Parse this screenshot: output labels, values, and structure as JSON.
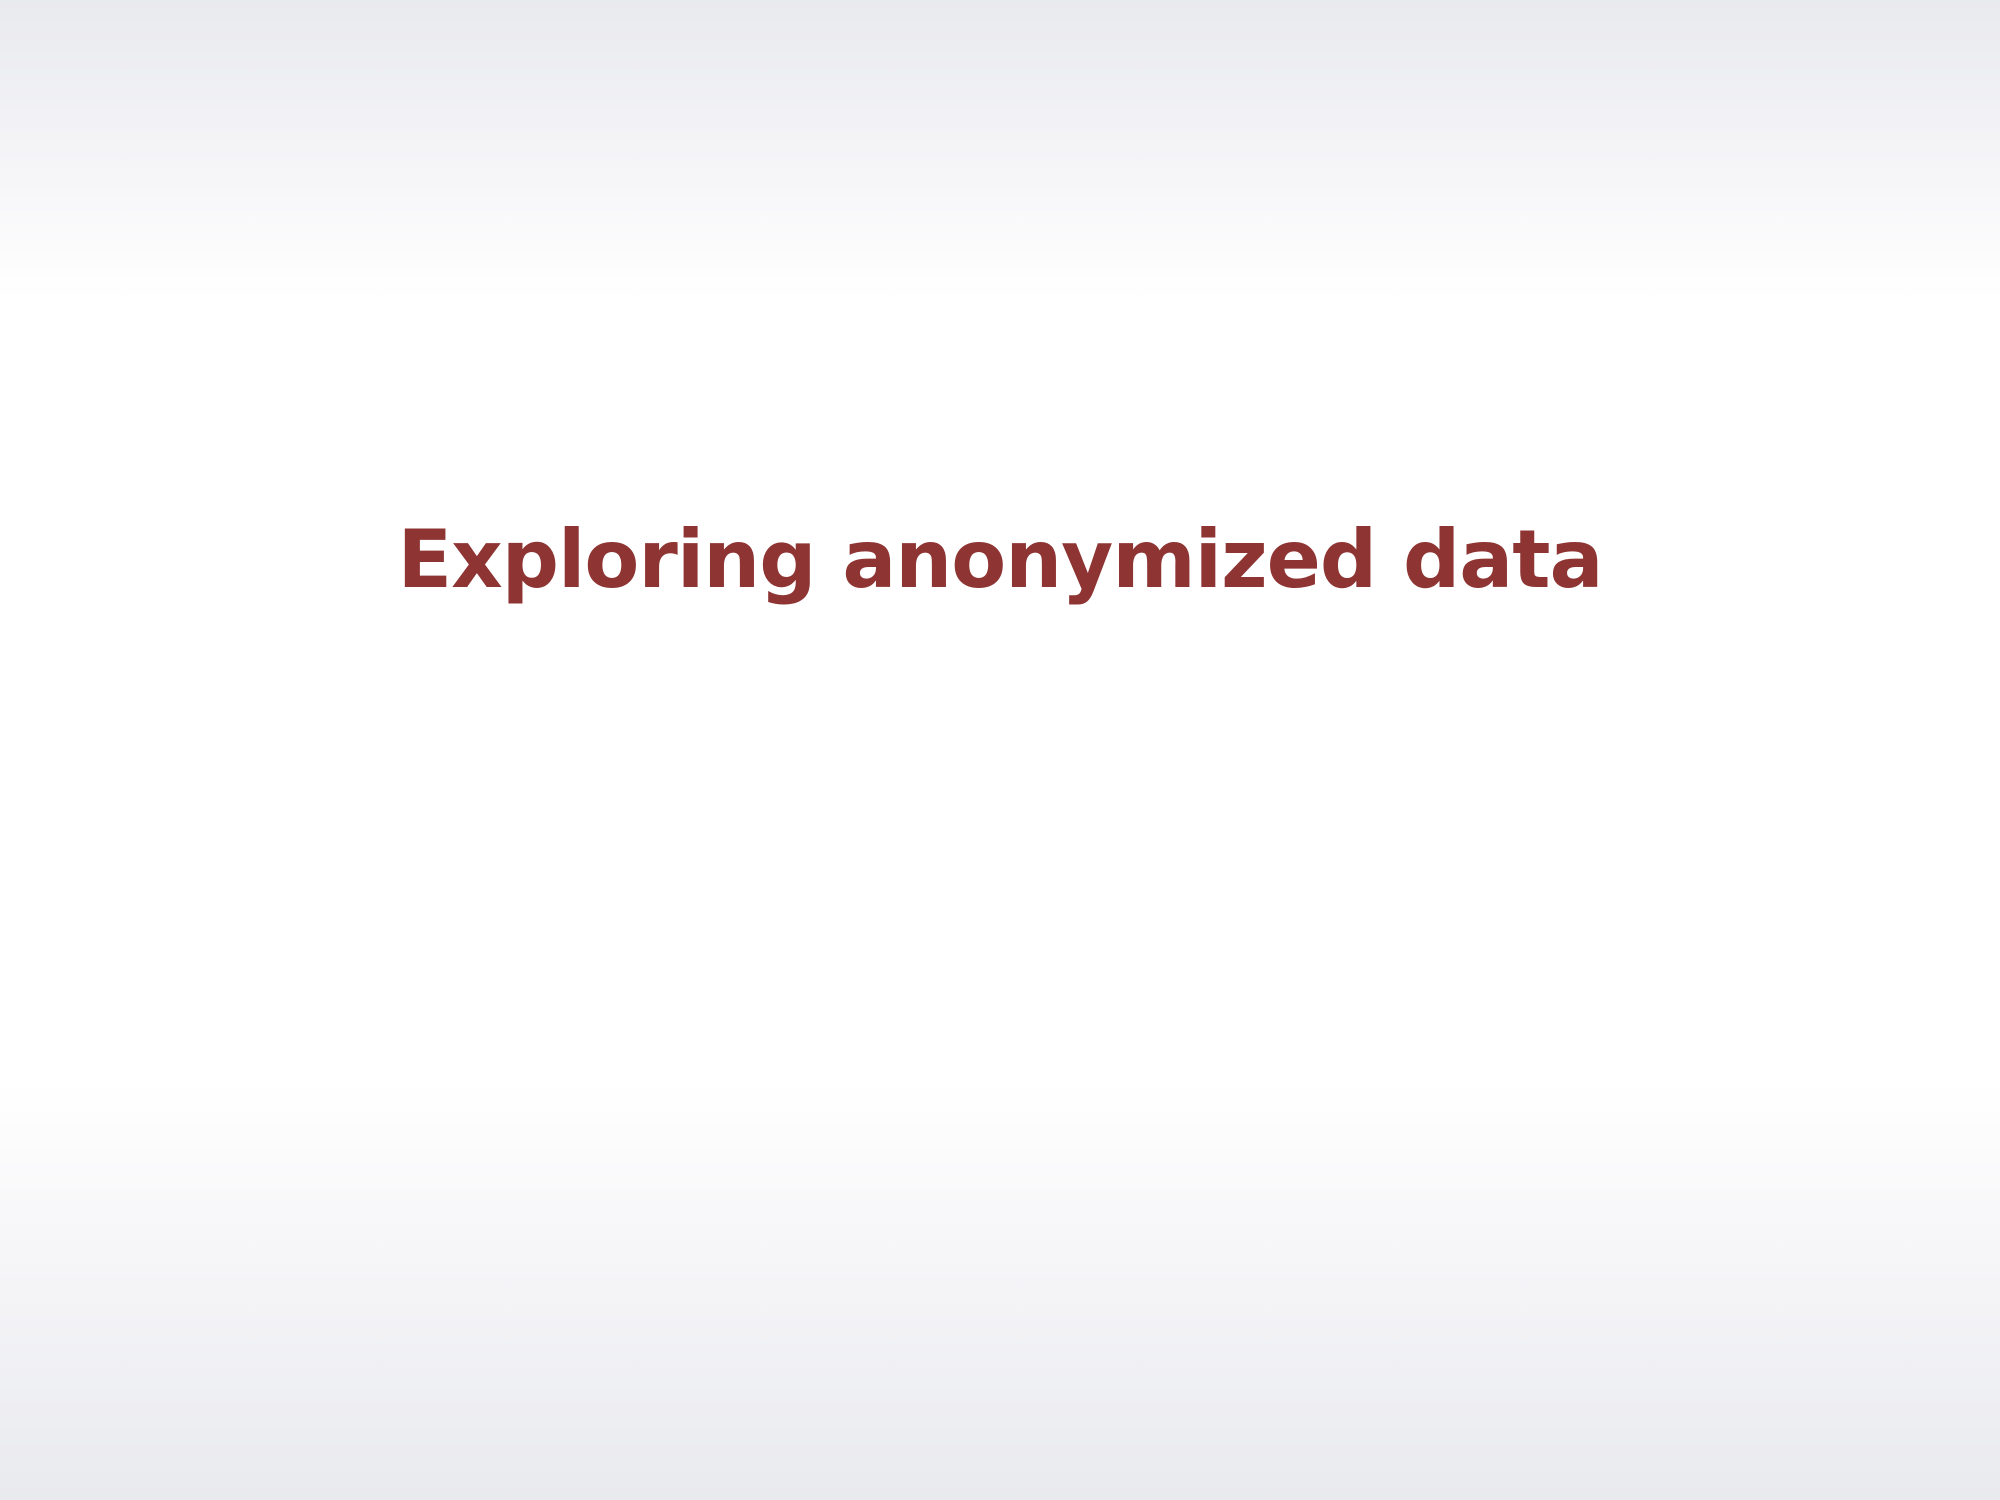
{
  "slide": {
    "title": "Exploring anonymized data",
    "title_color": "#8e3433"
  }
}
